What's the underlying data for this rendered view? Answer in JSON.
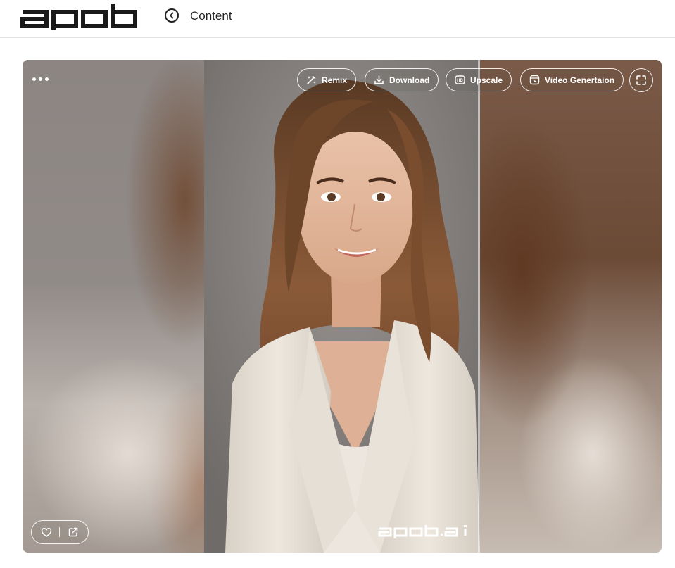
{
  "header": {
    "logo_text": "apob",
    "back_icon": "chevron-left-circle-icon",
    "title": "Content"
  },
  "toolbar": {
    "more_icon": "more-horizontal-icon",
    "buttons": [
      {
        "label": "Remix",
        "icon": "magic-wand-icon"
      },
      {
        "label": "Download",
        "icon": "download-icon"
      },
      {
        "label": "Upscale",
        "icon": "hd-icon"
      },
      {
        "label": "Video Genertaion",
        "icon": "video-icon"
      }
    ],
    "fullscreen_icon": "fullscreen-icon"
  },
  "image": {
    "watermark": "apob.ai"
  },
  "actions": {
    "like_icon": "heart-icon",
    "share_icon": "share-icon"
  }
}
